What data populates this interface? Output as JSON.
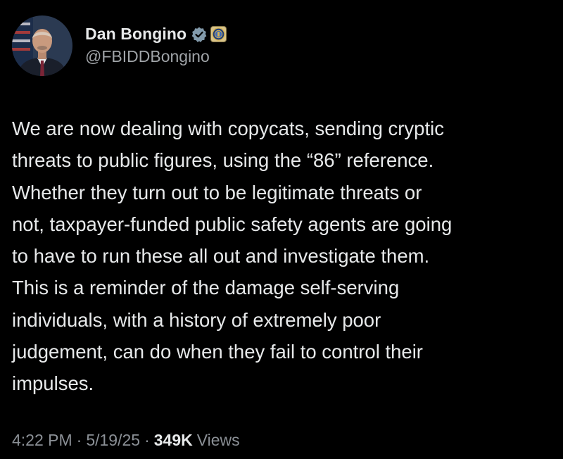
{
  "author": {
    "display_name": "Dan Bongino",
    "handle": "@FBIDDBongino",
    "avatar_icon": "profile-photo-avatar",
    "verified_icon": "verified-badge-icon",
    "affiliate_icon": "fbi-seal-icon",
    "verified_color": "#829aab"
  },
  "tweet": {
    "lines": [
      "We are now dealing with copycats, sending cryptic",
      "threats to public figures, using the “86” reference.",
      "Whether they turn out to be legitimate threats or",
      "not, taxpayer-funded public safety agents are going",
      "to have to run these all out and investigate them.",
      "This is a reminder of the damage self-serving",
      "individuals, with a history of extremely poor",
      "judgement, can do when they fail to control their",
      "impulses."
    ]
  },
  "meta": {
    "time": "4:22 PM",
    "separator": "·",
    "date": "5/19/25",
    "views_count": "349K",
    "views_label": "Views"
  },
  "colors": {
    "background": "#000000",
    "text": "#e7e9ea",
    "secondary": "#8b9096"
  }
}
